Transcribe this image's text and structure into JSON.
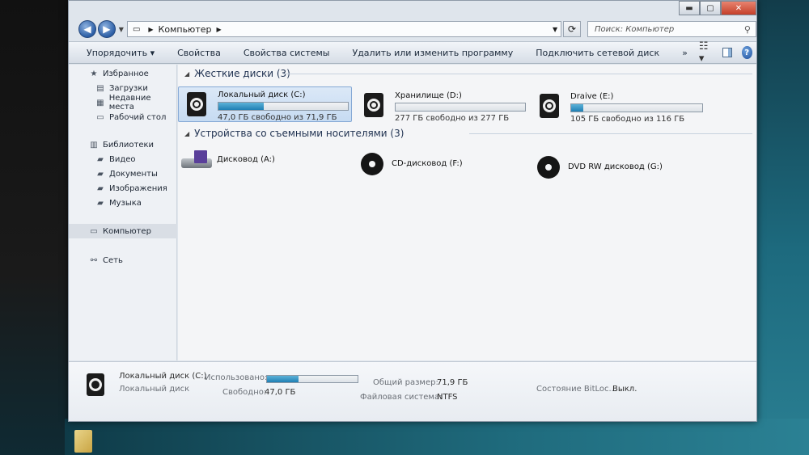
{
  "window": {
    "controls": {
      "minimize": "▬",
      "maximize": "▢",
      "close": "✕"
    }
  },
  "address": {
    "location": "Компьютер",
    "search_placeholder": "Поиск: Компьютер"
  },
  "toolbar": {
    "organize": "Упорядочить ▾",
    "properties": "Свойства",
    "system_properties": "Свойства системы",
    "uninstall": "Удалить или изменить программу",
    "map_drive": "Подключить сетевой диск",
    "more": "»"
  },
  "sidebar": {
    "favorites": "Избранное",
    "downloads": "Загрузки",
    "recent": "Недавние места",
    "desktop": "Рабочий стол",
    "libraries": "Библиотеки",
    "video": "Видео",
    "documents": "Документы",
    "images": "Изображения",
    "music": "Музыка",
    "computer": "Компьютер",
    "network": "Сеть"
  },
  "content": {
    "hard_drives_header": "Жесткие диски (3)",
    "removable_header": "Устройства со съемными носителями (3)",
    "drives": [
      {
        "name": "Локальный диск (C:)",
        "free_text": "47,0 ГБ свободно из 71,9 ГБ",
        "used_fraction": 0.35
      },
      {
        "name": "Хранилище (D:)",
        "free_text": "277 ГБ свободно из 277 ГБ",
        "used_fraction": 0.0
      },
      {
        "name": "Draive (E:)",
        "free_text": "105 ГБ свободно из 116 ГБ",
        "used_fraction": 0.09
      }
    ],
    "removable": [
      {
        "name": "Дисковод (A:)"
      },
      {
        "name": "CD-дисковод (F:)"
      },
      {
        "name": "DVD RW дисковод (G:)"
      }
    ]
  },
  "details": {
    "name": "Локальный диск (C:)",
    "type": "Локальный диск",
    "used_label": "Использовано:",
    "used_fraction": 0.35,
    "free_label": "Свободно:",
    "free_value": "47,0 ГБ",
    "total_label": "Общий размер:",
    "total_value": "71,9 ГБ",
    "fs_label": "Файловая система:",
    "fs_value": "NTFS",
    "bitlocker_label": "Состояние BitLoc...",
    "bitlocker_value": "Выкл."
  }
}
